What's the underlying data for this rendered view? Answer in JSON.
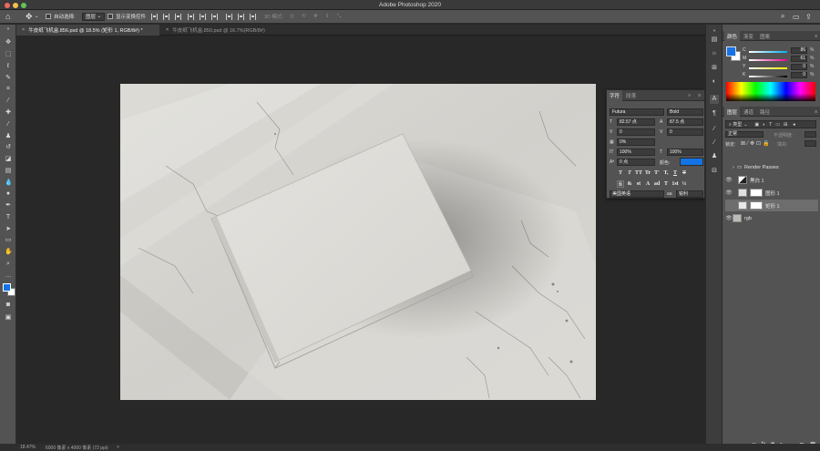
{
  "window": {
    "title": "Adobe Photoshop 2020",
    "traffic": {
      "close": "#ed6a5e",
      "minimize": "#f5bf4f",
      "zoom": "#61c554"
    }
  },
  "options_bar": {
    "home_icon": "home-icon",
    "move_icon": "move-tool-icon",
    "auto_select_label": "自动选择:",
    "auto_select_value": "图层",
    "show_transform_label": "显示变换控件",
    "mode_3d_label": "3D 模式:"
  },
  "document_tabs": [
    {
      "label": "牛皮纸飞机盒.856.psd @ 18.5% (矩形 1, RGB/8#) *",
      "active": true
    },
    {
      "label": "牛皮纸飞机盒.850.psd @ 16.7%(RGB/8#)",
      "active": false
    }
  ],
  "status_bar": {
    "zoom": "18.47%",
    "doc_info": "6000 像素 x 4000 像素 (72 ppi)",
    "arrow": ">"
  },
  "color_panel": {
    "tabs": [
      "颜色",
      "渐变",
      "图案"
    ],
    "channels": [
      {
        "label": "C",
        "value": "86",
        "unit": "%",
        "gradient_from": "#00aeef",
        "gradient_to": "#ffffff"
      },
      {
        "label": "M",
        "value": "61",
        "unit": "%",
        "gradient_from": "#ec008c",
        "gradient_to": "#ffffff"
      },
      {
        "label": "Y",
        "value": "0",
        "unit": "%",
        "gradient_from": "#fff200",
        "gradient_to": "#ffffff"
      },
      {
        "label": "K",
        "value": "0",
        "unit": "%",
        "gradient_from": "#000000",
        "gradient_to": "#ffffff"
      }
    ],
    "fg_color": "#1473e6",
    "bg_color": "#ffffff"
  },
  "character_panel": {
    "tabs": [
      "字符",
      "段落"
    ],
    "font_family": "Futura",
    "font_style": "Bold",
    "font_size": "82.57 点",
    "leading": "87.5 点",
    "kerning": "0",
    "tracking": "0",
    "scale_pct": "0%",
    "vertical_scale": "100%",
    "horizontal_scale": "100%",
    "baseline_shift": "0 点",
    "color_label": "颜色:",
    "text_color": "#1473e6",
    "style_buttons": [
      "T",
      "T",
      "TT",
      "Tr",
      "T'",
      "T,",
      "T",
      "T"
    ],
    "opentype_buttons": [
      "fi",
      "&",
      "st",
      "A",
      "ad",
      "T",
      "1st",
      "½"
    ],
    "language": "美国英语",
    "aa_icon": "aa",
    "antialias": "锐利"
  },
  "layers_panel": {
    "tabs": [
      "图层",
      "通道",
      "路径"
    ],
    "filter_label": "类型",
    "blend_mode": "正常",
    "opacity_label": "不透明度:",
    "lock_label": "锁定:",
    "fill_label": "填充:",
    "layers": [
      {
        "name": "Render Passes",
        "type": "group",
        "visible": false
      },
      {
        "name": "黑白 1",
        "type": "adjustment",
        "visible": true
      },
      {
        "name": "图形 1",
        "type": "masked",
        "visible": true
      },
      {
        "name": "矩形 1",
        "type": "smart",
        "visible": false,
        "selected": true
      },
      {
        "name": "rgb",
        "type": "pixel",
        "visible": true
      }
    ],
    "footer_icons": [
      "link-icon",
      "fx-icon",
      "mask-icon",
      "adjustment-icon",
      "folder-icon",
      "new-layer-icon",
      "trash-icon"
    ]
  },
  "toolbox_icons": [
    "move-icon",
    "marquee-icon",
    "lasso-icon",
    "quick-select-icon",
    "crop-icon",
    "eyedropper-icon",
    "healing-icon",
    "brush-icon",
    "stamp-icon",
    "history-brush-icon",
    "eraser-icon",
    "gradient-icon",
    "blur-icon",
    "dodge-icon",
    "pen-icon",
    "type-icon",
    "path-select-icon",
    "shape-icon",
    "hand-icon",
    "zoom-icon",
    "more-icon"
  ]
}
